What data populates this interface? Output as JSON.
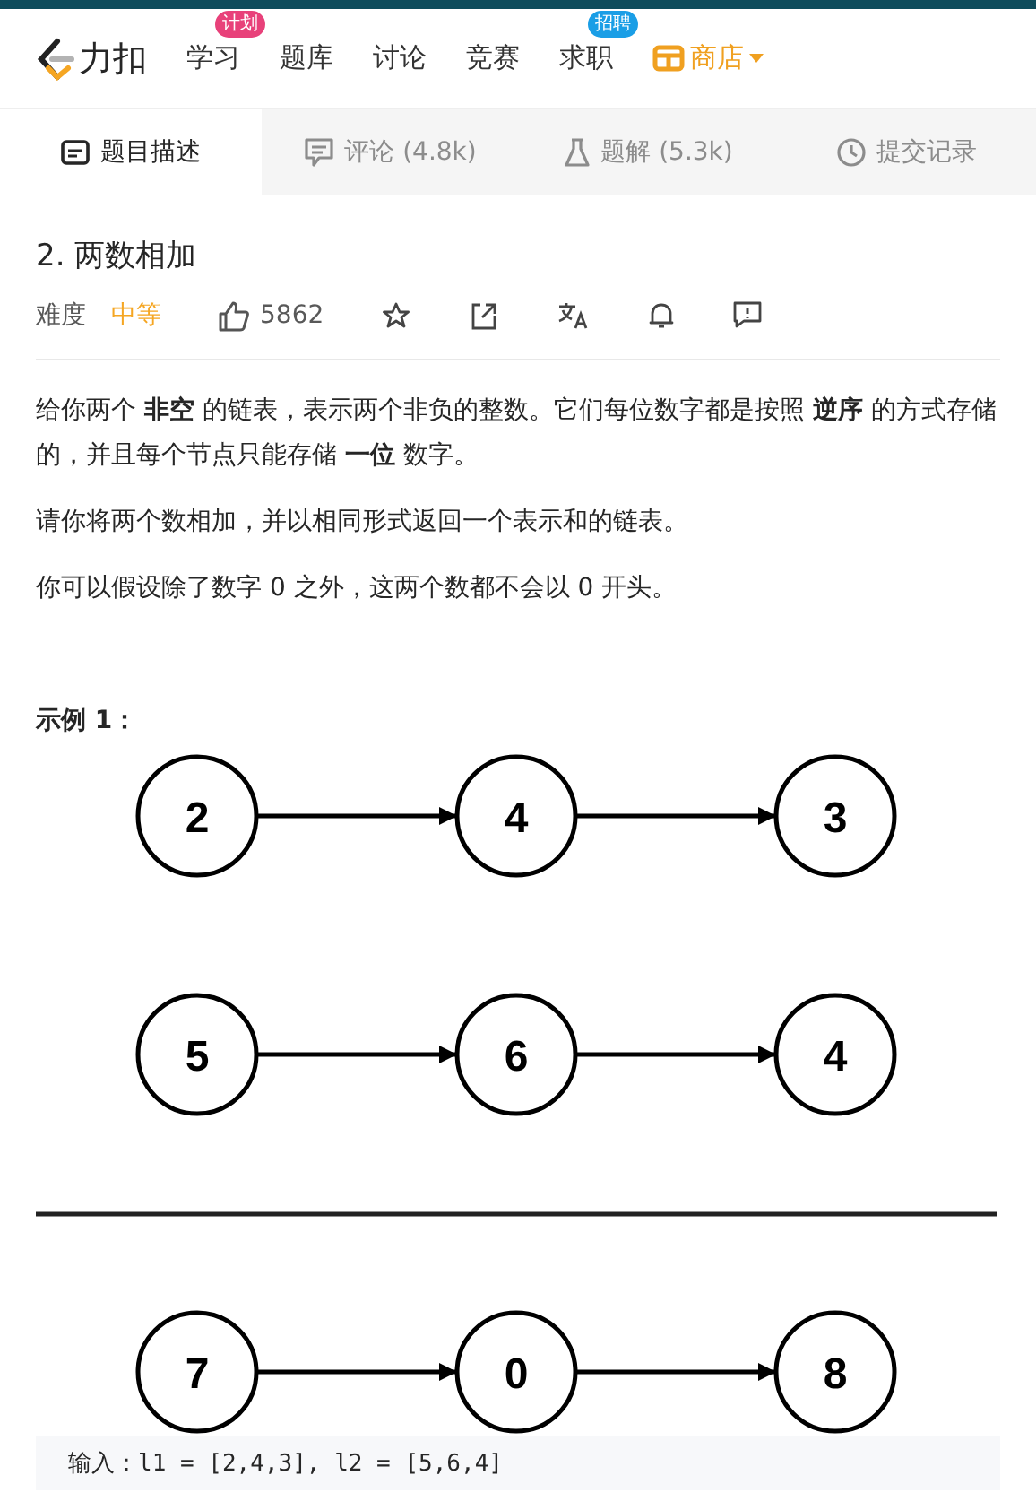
{
  "nav": {
    "logo": "力扣",
    "items": [
      {
        "label": "学习",
        "badge": "计划",
        "color": "#e8417a",
        "kind": "link"
      },
      {
        "label": "题库",
        "kind": "link"
      },
      {
        "label": "讨论",
        "kind": "link"
      },
      {
        "label": "竞赛",
        "kind": "link"
      },
      {
        "label": "求职",
        "badge": "招聘",
        "color": "#1a9ee6",
        "kind": "link"
      },
      {
        "label": "商店",
        "kind": "shop"
      }
    ]
  },
  "tabs": [
    {
      "label": "题目描述",
      "selected": true
    },
    {
      "label": "评论 (4.8k)",
      "selected": false
    },
    {
      "label": "题解 (5.3k)",
      "selected": false
    },
    {
      "label": "提交记录",
      "selected": false
    }
  ],
  "problem": {
    "title": "2. 两数相加",
    "difficulty_label": "难度",
    "difficulty": "中等",
    "likes": "5862",
    "paragraphs": [
      "给你两个 **非空** 的链表，表示两个非负的整数。它们每位数字都是按照 **逆序** 的方式存储的，并且每个节点只能存储 **一位** 数字。",
      "请你将两个数相加，并以相同形式返回一个表示和的链表。",
      "你可以假设除了数字 0 之外，这两个数都不会以 0 开头。"
    ],
    "example_title": "示例 1：",
    "diagram": {
      "inputs": [
        [
          "2",
          "4",
          "3"
        ],
        [
          "5",
          "6",
          "4"
        ]
      ],
      "output": [
        "7",
        "0",
        "8"
      ]
    },
    "input_line": "输入：l1 = [2,4,3], l2 = [5,6,4]"
  }
}
